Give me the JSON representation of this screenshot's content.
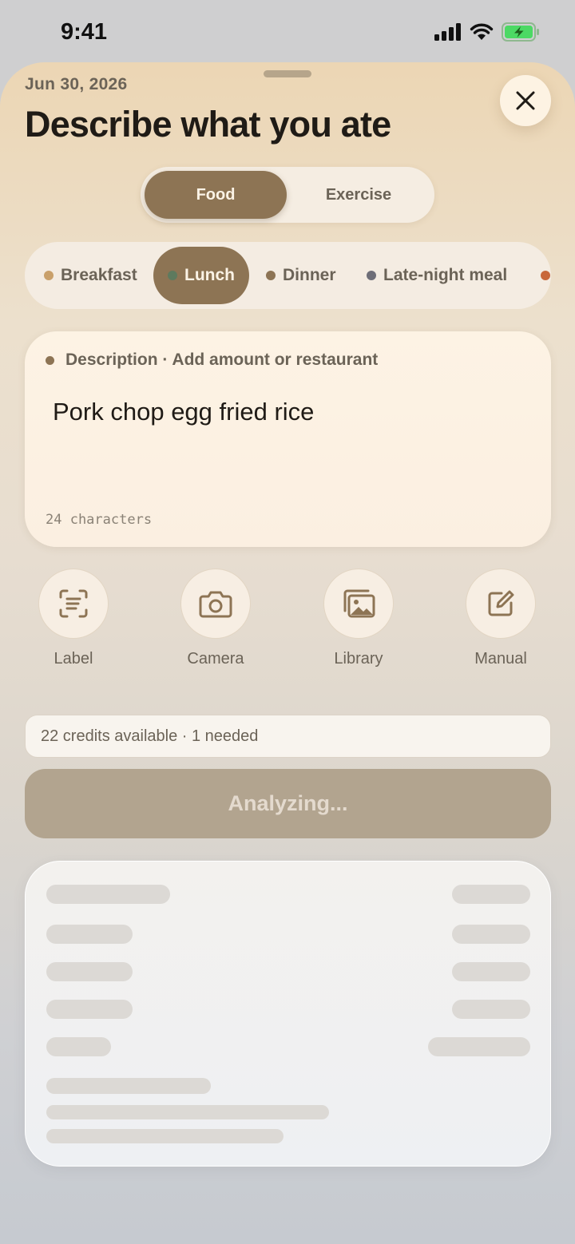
{
  "status": {
    "time": "9:41"
  },
  "header": {
    "date": "Jun 30, 2026",
    "title": "Describe what you ate"
  },
  "segment": {
    "food": "Food",
    "exercise": "Exercise",
    "selected": "Food"
  },
  "meals": {
    "selected": "Lunch",
    "items": [
      {
        "label": "Breakfast",
        "color": "#c9a06a"
      },
      {
        "label": "Lunch",
        "color": "#5e7a5e"
      },
      {
        "label": "Dinner",
        "color": "#8d7454"
      },
      {
        "label": "Late-night meal",
        "color": "#6e6e78"
      }
    ],
    "extra_dot_color": "#c8673a"
  },
  "description": {
    "label": "Description · Add amount or restaurant",
    "value": "Pork chop egg fried rice",
    "char_count": "24 characters"
  },
  "actions": {
    "label": "Label",
    "camera": "Camera",
    "library": "Library",
    "manual": "Manual"
  },
  "credits": {
    "text": "22 credits available · 1 needed"
  },
  "analyze": {
    "label": "Analyzing..."
  },
  "colors": {
    "accent": "#8d7454",
    "button_disabled": "#b2a48f"
  }
}
